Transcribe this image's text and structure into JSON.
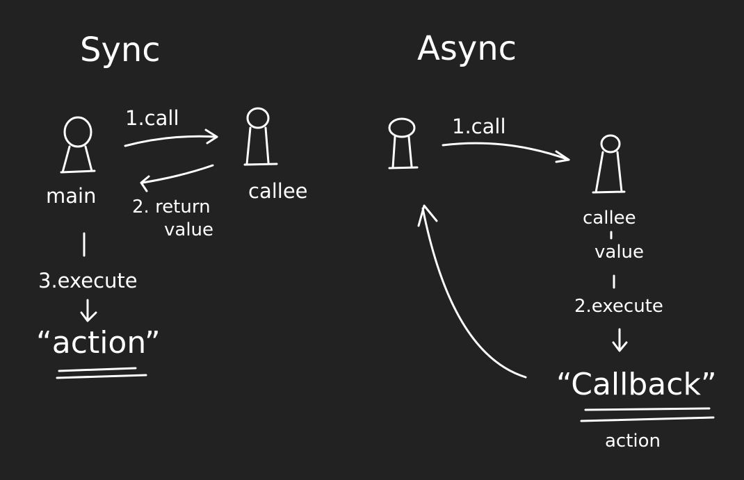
{
  "sync": {
    "title": "Sync",
    "caller_label": "main",
    "callee_label": "callee",
    "call_label": "1.call",
    "return_label_line1": "2. return",
    "return_label_line2": "value",
    "execute_label": "3.execute",
    "action_label": "“action”"
  },
  "async": {
    "title": "Async",
    "call_label": "1.call",
    "callee_label": "callee",
    "value_label": "value",
    "execute_label": "2.execute",
    "callback_label": "“Callback”",
    "action_label": "action"
  }
}
